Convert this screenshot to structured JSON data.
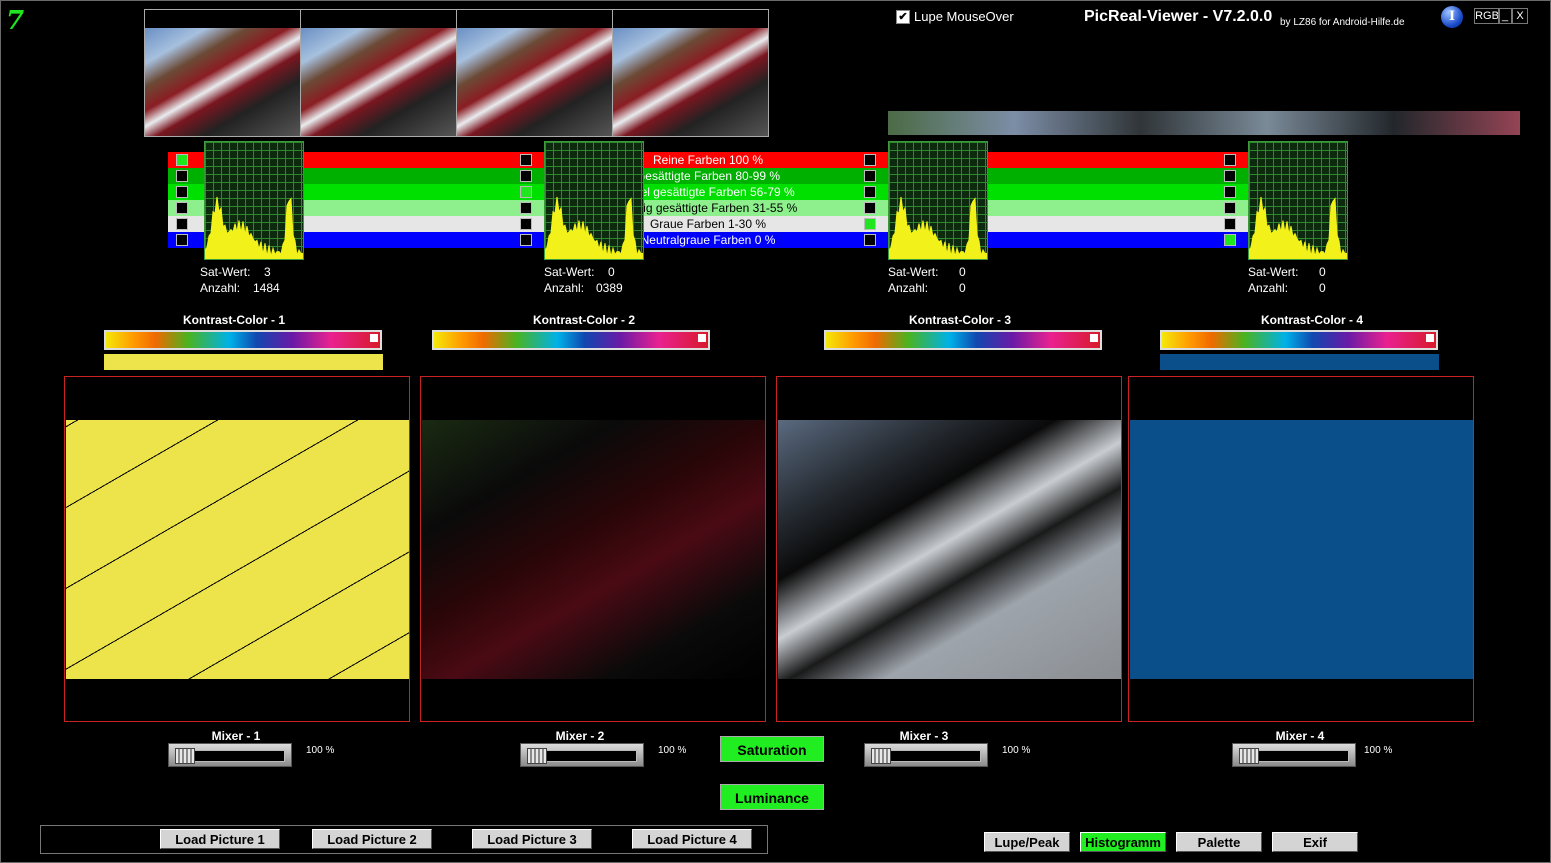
{
  "app": {
    "title": "PicReal-Viewer - V7.2.0.0",
    "subtitle": "by LZ86 for Android-Hilfe.de",
    "logo": "7",
    "info_icon": "I",
    "window_buttons": [
      "RGB",
      "_",
      "X"
    ]
  },
  "lupe_mouseover": {
    "label": "Lupe MouseOver",
    "checked": true
  },
  "saturation_levels": [
    {
      "label": "Reine Farben 100 %",
      "color": "#ff0000",
      "text_color": "#ffffff"
    },
    {
      "label": "Gesättigte Farben  80-99 %",
      "color": "#00b000",
      "text_color": "#ffffff"
    },
    {
      "label": "Mittel gesättigte Farben  56-79 %",
      "color": "#00e000",
      "text_color": "#ffffff"
    },
    {
      "label": "Wenig gesättigte Farben  31-55 %",
      "color": "#8df08d",
      "text_color": "#000000"
    },
    {
      "label": "Graue Farben  1-30 %",
      "color": "#e6e6e6",
      "text_color": "#000000"
    },
    {
      "label": "Neutralgraue Farben  0 %",
      "color": "#0000ff",
      "text_color": "#ffffff"
    }
  ],
  "channels": [
    {
      "sat_label": "Sat-Wert:",
      "sat_value": "3",
      "count_label": "Anzahl:",
      "count_value": "1484",
      "kontrast_label": "Kontrast-Color - 1",
      "kontrast_color": "#ece44a",
      "mixer_label": "Mixer - 1",
      "mixer_percent": "100 %",
      "selected_level": 0
    },
    {
      "sat_label": "Sat-Wert:",
      "sat_value": "0",
      "count_label": "Anzahl:",
      "count_value": "0389",
      "kontrast_label": "Kontrast-Color - 2",
      "kontrast_color": "",
      "mixer_label": "Mixer - 2",
      "mixer_percent": "100 %",
      "selected_level": 2
    },
    {
      "sat_label": "Sat-Wert:",
      "sat_value": "0",
      "count_label": "Anzahl:",
      "count_value": "0",
      "kontrast_label": "Kontrast-Color - 3",
      "kontrast_color": "",
      "mixer_label": "Mixer - 3",
      "mixer_percent": "100 %",
      "selected_level": 4
    },
    {
      "sat_label": "Sat-Wert:",
      "sat_value": "0",
      "count_label": "Anzahl:",
      "count_value": "0",
      "kontrast_label": "Kontrast-Color - 4",
      "kontrast_color": "#0a4f8a",
      "mixer_label": "Mixer - 4",
      "mixer_percent": "100 %",
      "selected_level": 5
    }
  ],
  "mode_buttons": {
    "saturation": "Saturation",
    "luminance": "Luminance"
  },
  "load_buttons": [
    "Load Picture 1",
    "Load Picture 2",
    "Load Picture 3",
    "Load Picture 4"
  ],
  "view_buttons": [
    {
      "label": "Lupe/Peak",
      "active": false
    },
    {
      "label": "Histogramm",
      "active": true
    },
    {
      "label": "Palette",
      "active": false
    },
    {
      "label": "Exif",
      "active": false
    }
  ]
}
